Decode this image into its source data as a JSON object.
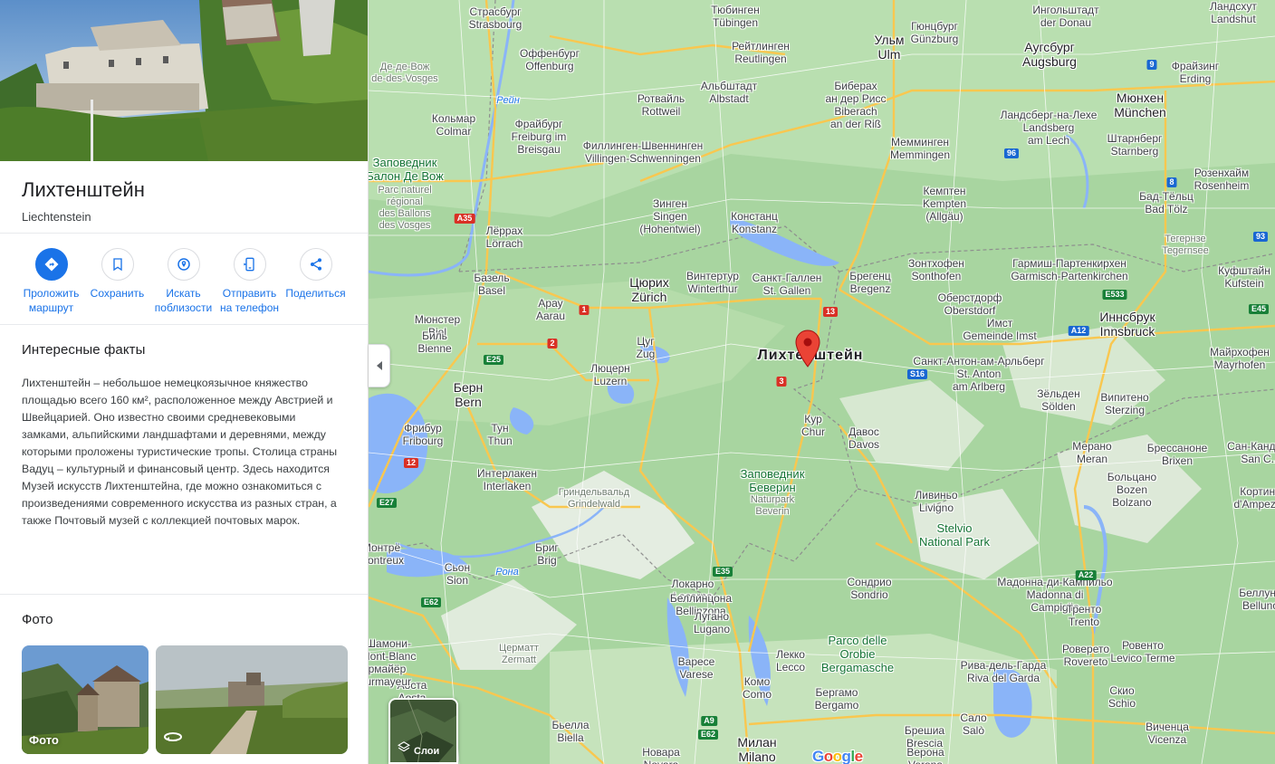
{
  "place": {
    "title": "Лихтенштейн",
    "subtitle": "Liechtenstein"
  },
  "actions": [
    {
      "label": "Проложить\nмаршрут",
      "icon": "directions-icon"
    },
    {
      "label": "Сохранить",
      "icon": "bookmark-icon"
    },
    {
      "label": "Искать\nпоблизости",
      "icon": "nearby-icon"
    },
    {
      "label": "Отправить\nна телефон",
      "icon": "send-to-phone-icon"
    },
    {
      "label": "Поделиться",
      "icon": "share-icon"
    }
  ],
  "facts": {
    "heading": "Интересные факты",
    "text": "Лихтенштейн – небольшое немецкоязычное княжество площадью всего 160 км², расположенное между Австрией и Швейцарией. Оно известно своими средневековыми замками, альпийскими ландшафтами и деревнями, между которыми проложены туристические тропы. Столица страны Вадуц – культурный и финансовый центр. Здесь находится Музей искусств Лихтенштейна, где можно ознакомиться с произведениями современного искусства из разных стран, а также Почтовый музей с коллекцией почтовых марок."
  },
  "photos": {
    "heading": "Фото",
    "first_caption": "Фото",
    "second_icon": "360-view-icon"
  },
  "map": {
    "layers_label": "Слои",
    "logo": "Google",
    "marker_label": "Лихтенштейн",
    "colors": {
      "land": "#a8d5a0",
      "water": "#8ab4f8",
      "road": "#fbc02d",
      "marker": "#ea4335"
    },
    "labels": [
      {
        "text": "Страсбург\nStrasbourg",
        "cls": ""
      },
      {
        "text": "Тюбинген\nTübingen",
        "cls": ""
      },
      {
        "text": "Гюнцбург\nGünzburg",
        "cls": ""
      },
      {
        "text": "Ингольштадт\nder Donau",
        "cls": ""
      },
      {
        "text": "Ландсхут\nLandshut",
        "cls": ""
      },
      {
        "text": "Оффенбург\nOffenburg",
        "cls": ""
      },
      {
        "text": "Рейтлинген\nReutlingen",
        "cls": ""
      },
      {
        "text": "Ульм\nUlm",
        "cls": "big"
      },
      {
        "text": "Аугсбург\nAugsburg",
        "cls": "big"
      },
      {
        "text": "Фрайзинг\nErding",
        "cls": ""
      },
      {
        "text": "Де-де-Вож\nde-des-Vosges",
        "cls": "region"
      },
      {
        "text": "Альбштадт\nAlbstadt",
        "cls": ""
      },
      {
        "text": "Биберах\nан дер Рисс\nBiberach\nan der Riß",
        "cls": ""
      },
      {
        "text": "Мюнхен\nMünchen",
        "cls": "big"
      },
      {
        "text": "Ротвайль\nRottweil",
        "cls": ""
      },
      {
        "text": "Ландсберг-на-Лехе\nLandsberg\nam Lech",
        "cls": ""
      },
      {
        "text": "Кольмар\nColmar",
        "cls": ""
      },
      {
        "text": "Фрайбург\nFreiburg im\nBreisgau",
        "cls": ""
      },
      {
        "text": "Филлинген-Швеннинген\nVillingen-Schwenningen",
        "cls": ""
      },
      {
        "text": "Мемминген\nMemmingen",
        "cls": ""
      },
      {
        "text": "Штарнберг\nStarnberg",
        "cls": ""
      },
      {
        "text": "Заповедник\nБалон Де Вож",
        "cls": "park"
      },
      {
        "text": "Parc naturel\nrégional\ndes Ballons\ndes Vosges",
        "cls": "region"
      },
      {
        "text": "Розенхайм\nRosenheim",
        "cls": ""
      },
      {
        "text": "Бад-Тёльц\nBad Tölz",
        "cls": ""
      },
      {
        "text": "Зинген\nSingen\n(Hohentwiel)",
        "cls": ""
      },
      {
        "text": "Констанц\nKonstanz",
        "cls": ""
      },
      {
        "text": "Кемптен\nKempten\n(Allgäu)",
        "cls": ""
      },
      {
        "text": "Лёррах\nLörrach",
        "cls": ""
      },
      {
        "text": "Тегернзе\nTegernsee",
        "cls": "region"
      },
      {
        "text": "Гармиш-Партенкирхен\nGarmisch-Partenkirchen",
        "cls": ""
      },
      {
        "text": "Зонтхофен\nSonthofen",
        "cls": ""
      },
      {
        "text": "Куфштайн\nKufstein",
        "cls": ""
      },
      {
        "text": "Базель\nBasel",
        "cls": ""
      },
      {
        "text": "Цюрих\nZürich",
        "cls": "big"
      },
      {
        "text": "Винтертур\nWinterthur",
        "cls": ""
      },
      {
        "text": "Санкт-Галлен\nSt. Gallen",
        "cls": ""
      },
      {
        "text": "Брегенц\nBregenz",
        "cls": ""
      },
      {
        "text": "Оберстдорф\nOberstdorf",
        "cls": ""
      },
      {
        "text": "Иннсбрук\nInnsbruck",
        "cls": "big"
      },
      {
        "text": "Арау\nAarau",
        "cls": ""
      },
      {
        "text": "Имст\nGemeinde Imst",
        "cls": ""
      },
      {
        "text": "Мюнстер\nBiel",
        "cls": ""
      },
      {
        "text": "Биль\nBienne",
        "cls": ""
      },
      {
        "text": "Цуг\nZug",
        "cls": ""
      },
      {
        "text": "Лихтенштейн",
        "cls": "country"
      },
      {
        "text": "Санкт-Антон-ам-Арльберг\nSt. Anton\nam Arlberg",
        "cls": ""
      },
      {
        "text": "Майрхофен\nMayrhofen",
        "cls": ""
      },
      {
        "text": "Берн\nBern",
        "cls": "big"
      },
      {
        "text": "Люцерн\nLuzern",
        "cls": ""
      },
      {
        "text": "Зёльден\nSölden",
        "cls": ""
      },
      {
        "text": "Випитено\nSterzing",
        "cls": ""
      },
      {
        "text": "Кур\nChur",
        "cls": ""
      },
      {
        "text": "Давос\nDavos",
        "cls": ""
      },
      {
        "text": "Фрибур\nFribourg",
        "cls": ""
      },
      {
        "text": "Тун\nThun",
        "cls": ""
      },
      {
        "text": "Мерано\nMeran",
        "cls": ""
      },
      {
        "text": "Брессаноне\nBrixen",
        "cls": ""
      },
      {
        "text": "Сан-Кандидо\nSan C...",
        "cls": ""
      },
      {
        "text": "Интерлакен\nInterlaken",
        "cls": ""
      },
      {
        "text": "Заповедник\nБеверин",
        "cls": "park"
      },
      {
        "text": "Naturpark\nBeverin",
        "cls": "region"
      },
      {
        "text": "Больцано\nBozen\nBolzano",
        "cls": ""
      },
      {
        "text": "Кортина\nd'Ampezzo",
        "cls": ""
      },
      {
        "text": "Гриндельвальд\nGrindelwald",
        "cls": "region"
      },
      {
        "text": "Ливиньо\nLivigno",
        "cls": ""
      },
      {
        "text": "Stelvio\nNational Park",
        "cls": "park"
      },
      {
        "text": "Бриг\nBrig",
        "cls": ""
      },
      {
        "text": "Монтрё\nMontreux",
        "cls": ""
      },
      {
        "text": "Сьон\nSion",
        "cls": ""
      },
      {
        "text": "Локарно\nLocarno",
        "cls": ""
      },
      {
        "text": "Сондрио\nSondrio",
        "cls": ""
      },
      {
        "text": "Мадонна-ди-Кампильо\nMadonna di\nCampiglio",
        "cls": ""
      },
      {
        "text": "Беллинцона\nBellinzona",
        "cls": ""
      },
      {
        "text": "Беллуно\nBelluno",
        "cls": ""
      },
      {
        "text": "Тренто\nTrento",
        "cls": ""
      },
      {
        "text": "Лугано\nLugano",
        "cls": ""
      },
      {
        "text": "Лекко\nLecco",
        "cls": ""
      },
      {
        "text": "Parco delle\nOrobie\nBergamasche",
        "cls": "park"
      },
      {
        "text": "Рива-дель-Гарда\nRiva del Garda",
        "cls": ""
      },
      {
        "text": "Ровенто\nLevico Terme",
        "cls": ""
      },
      {
        "text": "Роверето\nRovereto",
        "cls": ""
      },
      {
        "text": "Церматт\nZermatt",
        "cls": "region"
      },
      {
        "text": "Варесе\nVarese",
        "cls": ""
      },
      {
        "text": "Комо\nComo",
        "cls": ""
      },
      {
        "text": "Бергамо\nBergamo",
        "cls": ""
      },
      {
        "text": "Аоста\nAosta",
        "cls": ""
      },
      {
        "text": "Скио\nSchio",
        "cls": ""
      },
      {
        "text": "Сало\nSalò",
        "cls": ""
      },
      {
        "text": "Бьелла\nBiella",
        "cls": ""
      },
      {
        "text": "Брешиа\nBrescia",
        "cls": ""
      },
      {
        "text": "Виченца\nVicenza",
        "cls": ""
      },
      {
        "text": "Новара\nNovara",
        "cls": ""
      },
      {
        "text": "Милан\nMilano",
        "cls": "big"
      },
      {
        "text": "Верона\nVerona",
        "cls": ""
      },
      {
        "text": "Шамони-\nMont-Blanc",
        "cls": ""
      },
      {
        "text": "Курмайёр\nCourmayeur",
        "cls": ""
      },
      {
        "text": "Рейн",
        "cls": "water"
      },
      {
        "text": "Рона",
        "cls": "water"
      }
    ],
    "shields": [
      {
        "text": "A35",
        "cls": "red"
      },
      {
        "text": "1",
        "cls": "red"
      },
      {
        "text": "2",
        "cls": "red"
      },
      {
        "text": "E25",
        "cls": "green"
      },
      {
        "text": "3",
        "cls": "red"
      },
      {
        "text": "13",
        "cls": "red"
      },
      {
        "text": "S16",
        "cls": "blue"
      },
      {
        "text": "E533",
        "cls": "green"
      },
      {
        "text": "A12",
        "cls": "blue"
      },
      {
        "text": "E45",
        "cls": "green"
      },
      {
        "text": "9",
        "cls": "blue"
      },
      {
        "text": "96",
        "cls": "blue"
      },
      {
        "text": "8",
        "cls": "blue"
      },
      {
        "text": "93",
        "cls": "blue"
      },
      {
        "text": "E27",
        "cls": "green"
      },
      {
        "text": "12",
        "cls": "red"
      },
      {
        "text": "E35",
        "cls": "green"
      },
      {
        "text": "E62",
        "cls": "green"
      },
      {
        "text": "A22",
        "cls": "green"
      },
      {
        "text": "A9",
        "cls": "green"
      },
      {
        "text": "E62",
        "cls": "green"
      }
    ]
  }
}
